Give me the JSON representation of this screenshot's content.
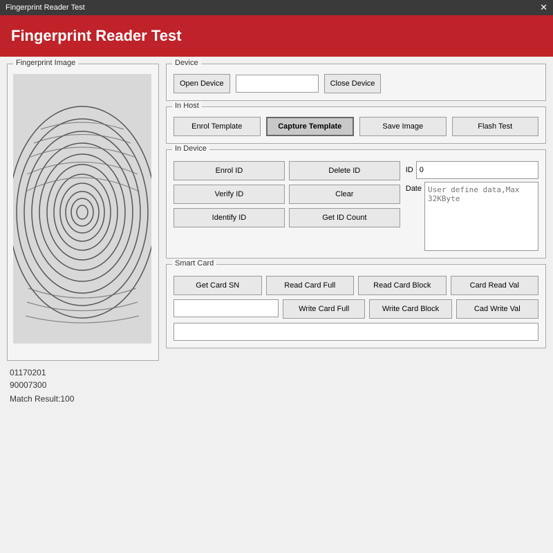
{
  "titleBar": {
    "title": "Fingerprint Reader Test",
    "closeLabel": "✕"
  },
  "header": {
    "title": "Fingerprint Reader Test"
  },
  "leftPanel": {
    "groupLabel": "Fingerprint Image",
    "infoLine1": "01170201",
    "infoLine2": "90007300",
    "matchResult": "Match Result:100"
  },
  "device": {
    "groupLabel": "Device",
    "openDeviceLabel": "Open Device",
    "closeDeviceLabel": "Close Device",
    "inputValue": ""
  },
  "inHost": {
    "groupLabel": "In Host",
    "buttons": [
      {
        "label": "Enrol Template",
        "active": false
      },
      {
        "label": "Capture Template",
        "active": true
      },
      {
        "label": "Save Image",
        "active": false
      },
      {
        "label": "Flash Test",
        "active": false
      }
    ]
  },
  "inDevice": {
    "groupLabel": "In Device",
    "enrolLabel": "Enrol ID",
    "deleteLabel": "Delete ID",
    "verifyLabel": "Verify ID",
    "clearLabel": "Clear",
    "identifyLabel": "Identify ID",
    "getCountLabel": "Get ID Count",
    "idLabel": "ID",
    "idValue": "0",
    "dateLabel": "Date",
    "dataPlaceholder": "User define data,Max 32KByte"
  },
  "smartCard": {
    "groupLabel": "Smart Card",
    "row1": [
      {
        "label": "Get Card SN"
      },
      {
        "label": "Read Card Full"
      },
      {
        "label": "Read Card Block"
      },
      {
        "label": "Card Read Val"
      }
    ],
    "row2": [
      {
        "label": ""
      },
      {
        "label": "Write Card Full"
      },
      {
        "label": "Write Card Block"
      },
      {
        "label": "Cad Write Val"
      }
    ],
    "inputValue": "",
    "snInputValue": ""
  }
}
